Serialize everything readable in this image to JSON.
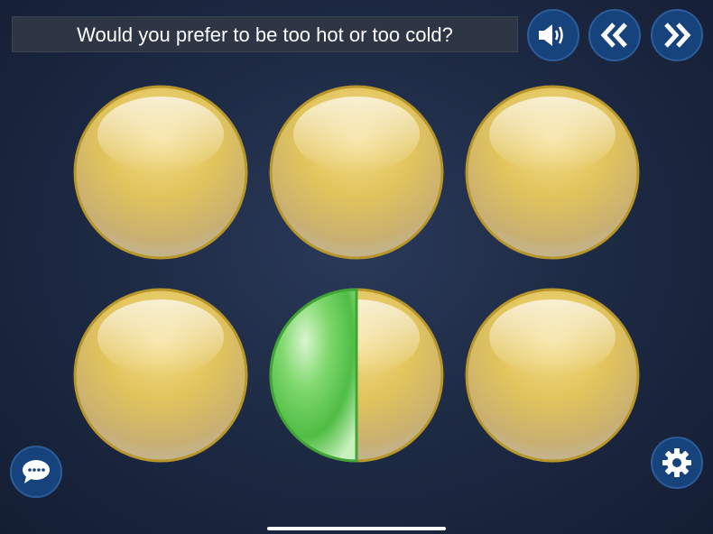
{
  "question": {
    "text": "Would you prefer to be too hot or too cold?"
  },
  "toolbar": {
    "sound_icon": "speaker-icon",
    "prev_icon": "double-chevron-left-icon",
    "next_icon": "double-chevron-right-icon"
  },
  "discs": [
    {
      "id": 1,
      "state": "idle"
    },
    {
      "id": 2,
      "state": "idle"
    },
    {
      "id": 3,
      "state": "idle"
    },
    {
      "id": 4,
      "state": "idle"
    },
    {
      "id": 5,
      "state": "timer",
      "progress": 0.5
    },
    {
      "id": 6,
      "state": "idle"
    }
  ],
  "footer": {
    "chat_icon": "chat-bubble-icon",
    "settings_icon": "gear-icon"
  },
  "colors": {
    "button": "#17437d",
    "disc_gold": "#e2c45c",
    "timer_green": "#5fce55"
  }
}
